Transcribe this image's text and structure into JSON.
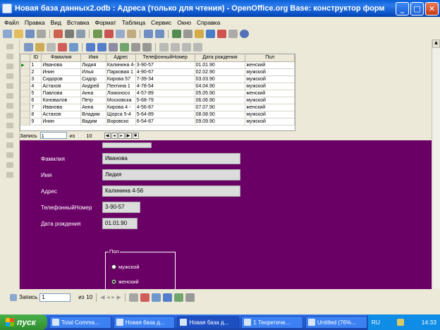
{
  "window": {
    "title": "Новая база данных2.odb : Адреса (только для чтения) - OpenOffice.org Base: конструктор форм",
    "minimize": "_",
    "maximize": "□",
    "close": "✕"
  },
  "menu": [
    "Файл",
    "Правка",
    "Вид",
    "Вставка",
    "Формат",
    "Таблица",
    "Сервис",
    "Окно",
    "Справка"
  ],
  "grid": {
    "columns": [
      "",
      "ID",
      "Фамилия",
      "Имя",
      "Адрес",
      "ТелефонныйНомер",
      "Дата рождения",
      "Пол"
    ],
    "rows": [
      [
        "▶",
        "1",
        "Иванова",
        "Лидия",
        "Калинина 4-56",
        "3-90-57",
        "01.01.90",
        "женский"
      ],
      [
        "",
        "2",
        "Инин",
        "Илья",
        "Парковая 1",
        "4-90-67",
        "02.02.90",
        "мужской"
      ],
      [
        "",
        "3",
        "Сидоров",
        "Сидор",
        "Кирова 57",
        "7-39-34",
        "03.03.90",
        "мужской"
      ],
      [
        "",
        "4",
        "Астахов",
        "Андрей",
        "Пехтина 1",
        "4-78-54",
        "04.04.90",
        "мужской"
      ],
      [
        "",
        "5",
        "Павлова",
        "Анна",
        "Ломоносо",
        "4-57-89",
        "05.05.90",
        "женский"
      ],
      [
        "",
        "6",
        "Коновалов",
        "Петр",
        "Московска",
        "5-68-79",
        "06.06.90",
        "мужской"
      ],
      [
        "",
        "7",
        "Иванова",
        "Анна",
        "Кирова 4 -",
        "4-56-87",
        "07.07.90",
        "женский"
      ],
      [
        "",
        "8",
        "Астахов",
        "Владим",
        "Щорса 5-4",
        "5-64-89",
        "08.08.90",
        "мужской"
      ],
      [
        "",
        "9",
        "Инин",
        "Вадим",
        "Воровско",
        "6-54-87",
        "09.09.90",
        "мужской"
      ]
    ],
    "nav": {
      "record_label": "Запись",
      "record_value": "1",
      "of_label": "из",
      "total": "10"
    }
  },
  "form": {
    "fields": [
      {
        "label": "Фамилия",
        "value": "Иванова"
      },
      {
        "label": "Имя",
        "value": "Лидия"
      },
      {
        "label": "Адрес",
        "value": "Калинина 4-56"
      },
      {
        "label": "ТелефонныйНомер",
        "value": "3-90-57"
      },
      {
        "label": "Дата рождения",
        "value": "01.01.90"
      }
    ],
    "gender_group": {
      "title": "Пол",
      "options": [
        "мужской",
        "женский"
      ],
      "selected": "женский"
    },
    "background_color": "#6a0066"
  },
  "formnav": {
    "record_label": "Запись",
    "record_value": "1",
    "of_label": "из",
    "total": "10"
  },
  "taskbar": {
    "start_label": "пуск",
    "tasks": [
      "Total Comma...",
      "Новая база д...",
      "Новая база д...",
      "1 Теоретиче...",
      "Untitled (76%..."
    ],
    "tray_lang": "RU",
    "clock": "14:33"
  }
}
